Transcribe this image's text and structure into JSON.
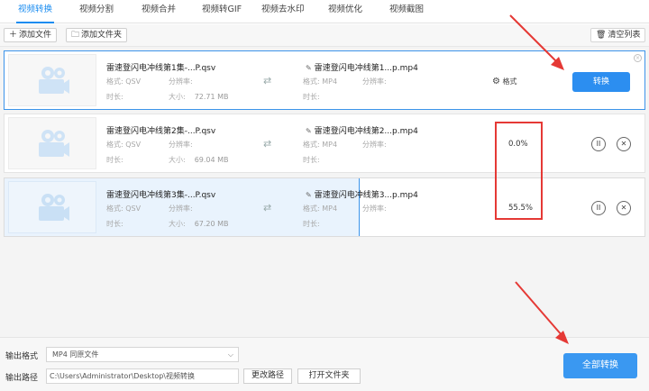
{
  "tabs": [
    "视频转换",
    "视频分割",
    "视频合并",
    "视频转GIF",
    "视频去水印",
    "视频优化",
    "视频截图"
  ],
  "toolbar": {
    "add_file": "添加文件",
    "add_folder": "添加文件夹",
    "clear_list": "清空列表"
  },
  "files": [
    {
      "name": "雷速登闪电冲线第1集-...P.qsv",
      "format_label": "格式: QSV",
      "resolution_label": "分辨率:",
      "duration_label": "时长:",
      "size_label": "大小:",
      "size_value": "72.71 MB",
      "out_name": "雷速登闪电冲线第1...p.mp4",
      "out_format": "格式: MP4",
      "out_resolution": "分辨率:",
      "out_duration": "时长:",
      "action_format": "格式",
      "action_convert": "转换"
    },
    {
      "name": "雷速登闪电冲线第2集-...P.qsv",
      "format_label": "格式: QSV",
      "resolution_label": "分辨率:",
      "duration_label": "时长:",
      "size_label": "大小:",
      "size_value": "69.04 MB",
      "out_name": "雷速登闪电冲线第2...p.mp4",
      "out_format": "格式: MP4",
      "out_resolution": "分辨率:",
      "out_duration": "时长:",
      "progress_text": "0.0%",
      "progress": 0.0
    },
    {
      "name": "雷速登闪电冲线第3集-...P.qsv",
      "format_label": "格式: QSV",
      "resolution_label": "分辨率:",
      "duration_label": "时长:",
      "size_label": "大小:",
      "size_value": "67.20 MB",
      "out_name": "雷速登闪电冲线第3...p.mp4",
      "out_format": "格式: MP4",
      "out_resolution": "分辨率:",
      "out_duration": "时长:",
      "progress_text": "55.5%",
      "progress": 0.555
    }
  ],
  "bottom": {
    "output_format_label": "输出格式",
    "output_format_value": "MP4  同原文件",
    "output_path_label": "输出路径",
    "output_path_value": "C:\\Users\\Administrator\\Desktop\\视频转换",
    "change_path": "更改路径",
    "open_folder": "打开文件夹",
    "convert_all": "全部转换"
  },
  "colors": {
    "accent": "#2c8ef0",
    "annotation": "#e53935"
  }
}
